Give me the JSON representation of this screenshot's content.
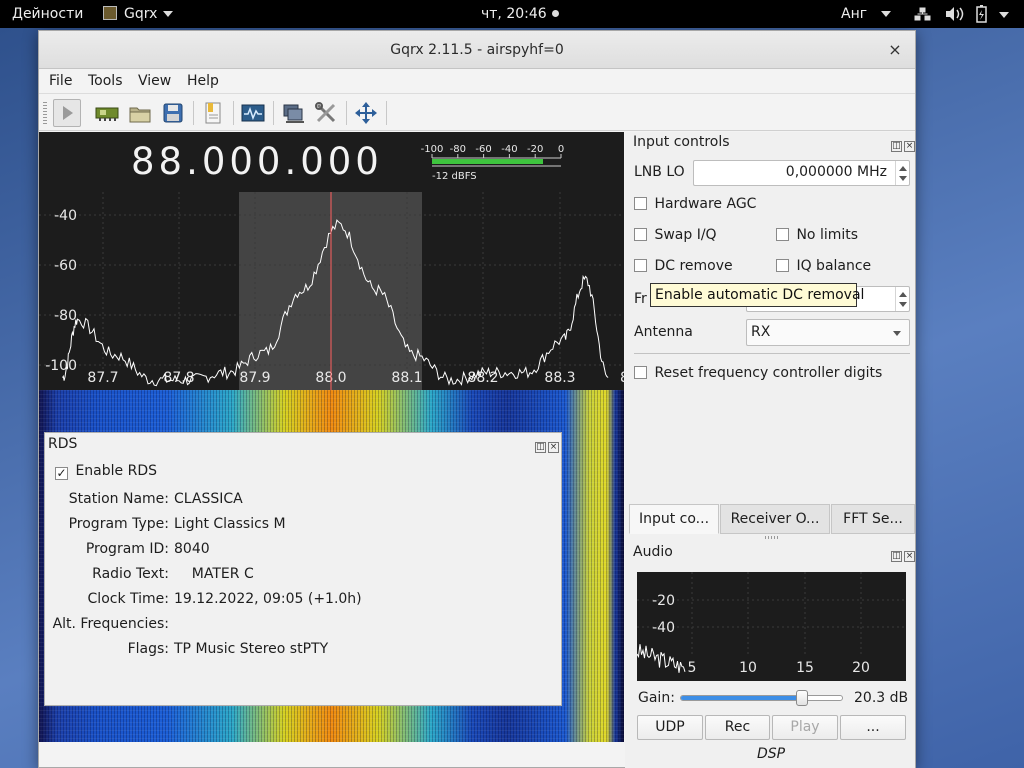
{
  "topbar": {
    "activities": "Дейности",
    "app_name": "Gqrx",
    "clock": "чт, 20:46",
    "language": "Анг"
  },
  "window": {
    "title": "Gqrx 2.11.5 - airspyhf=0",
    "close_glyph": "×"
  },
  "menu": {
    "file": "File",
    "tools": "Tools",
    "view": "View",
    "help": "Help"
  },
  "toolbar": {
    "icons": [
      "play-icon",
      "sdr-device-icon",
      "open-folder-icon",
      "save-icon",
      "bookmark-icon",
      "remote-control-icon",
      "network-icon",
      "settings-tools-icon",
      "fullscreen-icon"
    ]
  },
  "plot": {
    "frequency_display": "88.000.000",
    "meter_ticks": [
      "-100",
      "-80",
      "-60",
      "-40",
      "-20",
      "0"
    ],
    "meter_readout": "-12 dBFS",
    "y_ticks": [
      "-40",
      "-60",
      "-80",
      "-100"
    ],
    "x_ticks": [
      "87.7",
      "87.8",
      "87.9",
      "88.0",
      "88.1",
      "88.2",
      "88.3"
    ],
    "x_tick_edge": "8"
  },
  "chart_data": {
    "type": "line",
    "x": [
      87.63,
      87.65,
      87.7,
      87.75,
      87.8,
      87.85,
      87.9,
      87.95,
      88.0,
      88.05,
      88.1,
      88.15,
      88.2,
      88.25,
      88.3,
      88.33,
      88.36
    ],
    "y": [
      -105,
      -82,
      -96,
      -106,
      -106,
      -103,
      -95,
      -70,
      -44,
      -70,
      -96,
      -106,
      -103,
      -103,
      -90,
      -66,
      -105
    ],
    "ylim": [
      -110,
      -30
    ],
    "xlim": [
      87.62,
      88.38
    ],
    "grid": true,
    "color": "#ffffff",
    "marker_color": "#ff6060"
  },
  "rds": {
    "title": "RDS",
    "enable_label": "Enable RDS",
    "enable_checked": "✓",
    "fields": [
      {
        "label": "Station Name:",
        "value": "CLASSICA"
      },
      {
        "label": "Program Type:",
        "value": "Light Classics M"
      },
      {
        "label": "Program ID:",
        "value": "8040"
      },
      {
        "label": "Radio Text:",
        "value": "    MATER C"
      },
      {
        "label": "Clock Time:",
        "value": "19.12.2022, 09:05 (+1.0h)"
      },
      {
        "label": "Alt. Frequencies:",
        "value": ""
      },
      {
        "label": "Flags:",
        "value": "TP Music Stereo stPTY"
      }
    ]
  },
  "input_controls": {
    "title": "Input controls",
    "lnb_label": "LNB LO",
    "lnb_value": "0,000000 MHz",
    "hardware_agc": "Hardware AGC",
    "swap_iq": "Swap I/Q",
    "no_limits": "No limits",
    "dc_remove": "DC remove",
    "iq_balance": "IQ balance",
    "freq_corr_label": "Fr",
    "antenna_label": "Antenna",
    "antenna_value": "RX",
    "reset_label": "Reset frequency controller digits"
  },
  "tooltip": "Enable automatic DC removal",
  "tabs": [
    "Input co...",
    "Receiver O...",
    "FFT Se..."
  ],
  "audio": {
    "title": "Audio",
    "y_ticks": [
      "-20",
      "-40"
    ],
    "x_ticks": [
      "5",
      "10",
      "15",
      "20"
    ],
    "gain_label": "Gain:",
    "gain_value": "20.3 dB",
    "gain_fraction": 0.75,
    "buttons": [
      "UDP",
      "Rec",
      "Play",
      "..."
    ],
    "dsp_label": "DSP"
  }
}
